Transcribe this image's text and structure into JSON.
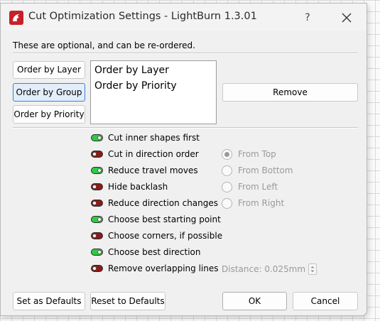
{
  "window": {
    "title": "Cut Optimization Settings - LightBurn 1.3.01",
    "help_glyph": "?",
    "app_icon": "lightburn-logo-icon",
    "close_icon": "close-icon"
  },
  "header": {
    "subtitle": "These are optional, and can be re-ordered."
  },
  "order_buttons": [
    {
      "label": "Order by Layer",
      "selected": false
    },
    {
      "label": "Order by Group",
      "selected": true
    },
    {
      "label": "Order by Priority",
      "selected": false
    }
  ],
  "order_list": {
    "items": [
      "Order by Layer",
      "Order by Priority"
    ]
  },
  "remove_button": {
    "label": "Remove"
  },
  "options": [
    {
      "label": "Cut inner shapes first",
      "enabled": true
    },
    {
      "label": "Cut in direction order",
      "enabled": false
    },
    {
      "label": "Reduce travel moves",
      "enabled": true
    },
    {
      "label": "Hide backlash",
      "enabled": false
    },
    {
      "label": "Reduce direction changes",
      "enabled": false
    },
    {
      "label": "Choose best starting point",
      "enabled": true
    },
    {
      "label": "Choose corners, if possible",
      "enabled": false
    },
    {
      "label": "Choose best direction",
      "enabled": true
    },
    {
      "label": "Remove overlapping lines",
      "enabled": false
    }
  ],
  "direction_radios": [
    {
      "label": "From Top",
      "checked": true
    },
    {
      "label": "From Bottom",
      "checked": false
    },
    {
      "label": "From Left",
      "checked": false
    },
    {
      "label": "From Right",
      "checked": false
    }
  ],
  "distance": {
    "label": "Distance: 0.025mm"
  },
  "footer": {
    "set_defaults": "Set as Defaults",
    "reset_defaults": "Reset to Defaults",
    "ok": "OK",
    "cancel": "Cancel"
  },
  "colors": {
    "toggle_on": "#2ecc40",
    "toggle_off": "#8b1a1a",
    "selected_border": "#3d7fd9",
    "disabled_text": "#9a9a9a"
  }
}
